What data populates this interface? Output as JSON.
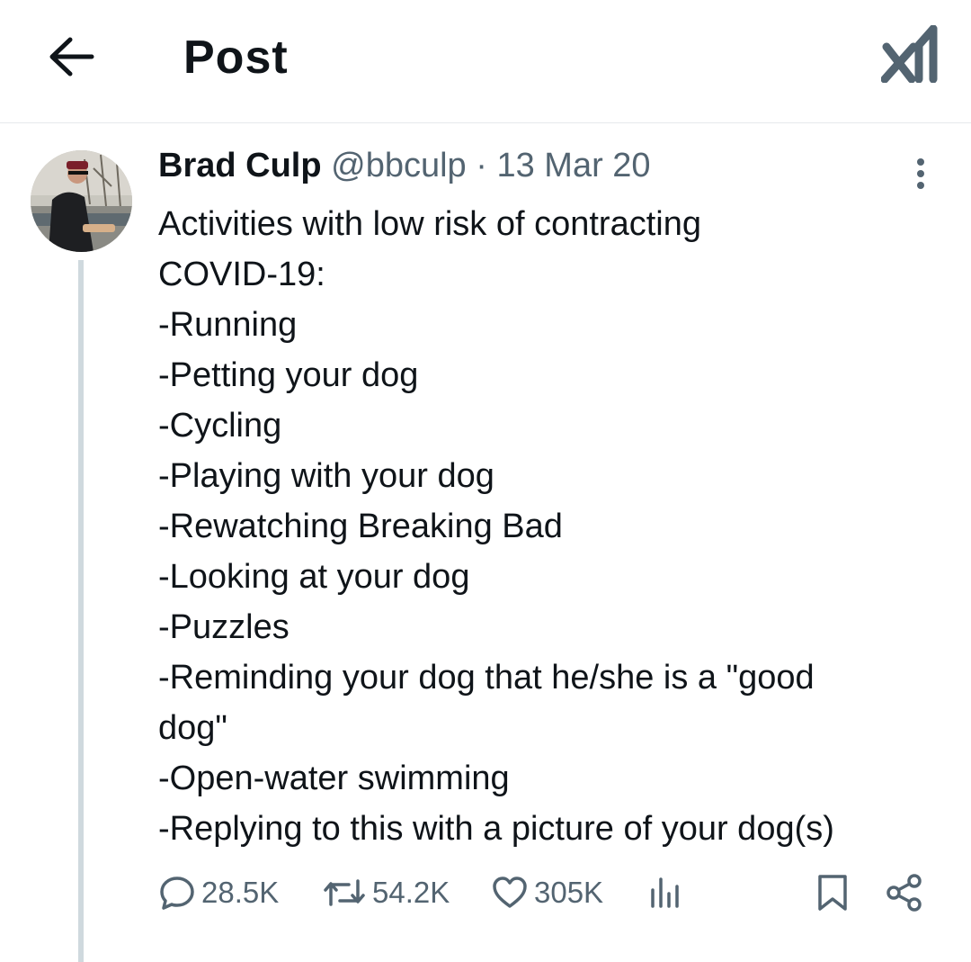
{
  "header": {
    "title": "Post",
    "back_icon": "arrow-left-icon",
    "logo_icon": "x-logo-icon"
  },
  "post": {
    "author_name": "Brad Culp",
    "author_handle": "@bbculp",
    "separator": "·",
    "date": "13 Mar 20",
    "text_lines": [
      "Activities with low risk of contracting",
      "COVID-19:",
      "-Running",
      "-Petting your dog",
      "-Cycling",
      "-Playing with your dog",
      "-Rewatching Breaking Bad",
      "-Looking at your dog",
      "-Puzzles",
      "-Reminding your dog that he/she is a \"good",
      "dog\"",
      "-Open-water swimming",
      "-Replying to this with a picture of your dog(s)"
    ],
    "metrics": {
      "replies": "28.5K",
      "reposts": "54.2K",
      "likes": "305K"
    }
  },
  "colors": {
    "text": "#0f1419",
    "secondary": "#536471",
    "thread_line": "#cfd9de",
    "divider": "#e6e9ec"
  }
}
